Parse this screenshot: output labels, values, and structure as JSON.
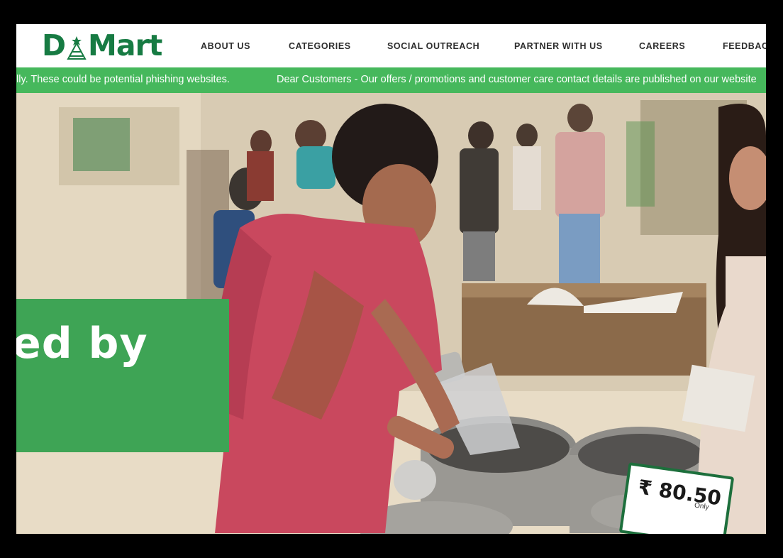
{
  "logo": {
    "text_left": "D",
    "text_right": "Mart",
    "brand_color": "#177b43"
  },
  "nav": {
    "items": [
      {
        "label": "ABOUT US"
      },
      {
        "label": "CATEGORIES"
      },
      {
        "label": "SOCIAL OUTREACH"
      },
      {
        "label": "PARTNER WITH US"
      },
      {
        "label": "CAREERS"
      },
      {
        "label": "FEEDBACK"
      }
    ]
  },
  "ticker": {
    "messages": [
      "lly. These could be potential phishing websites.",
      "Dear Customers - Our offers / promotions and customer care contact details are published on our website"
    ],
    "background": "#46b85c"
  },
  "hero": {
    "banner_text": "ed by",
    "banner_color": "#3ea455",
    "price_tag": {
      "price": "₹ 80.50",
      "note": "Only"
    }
  }
}
